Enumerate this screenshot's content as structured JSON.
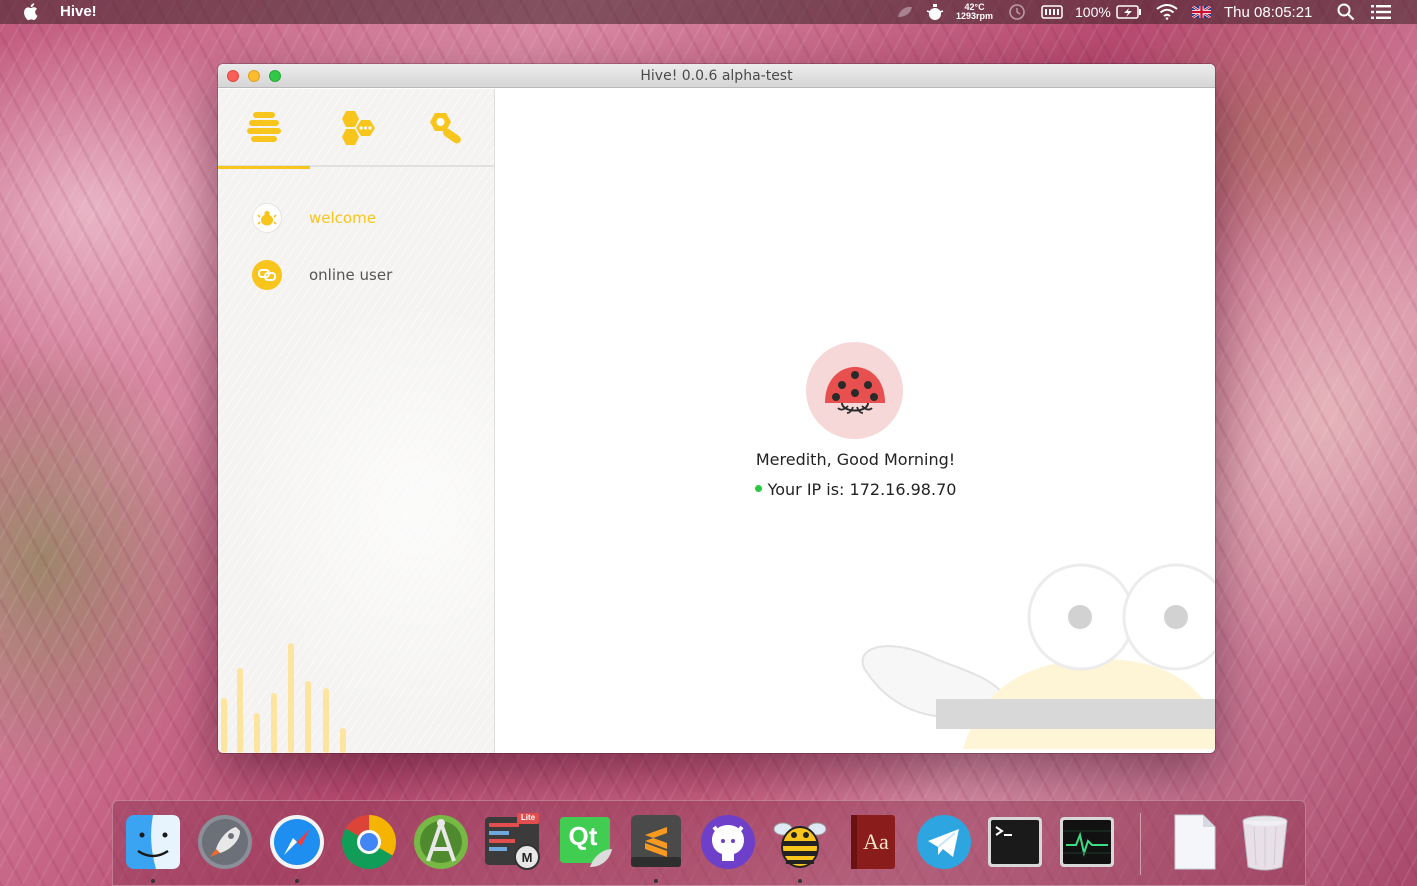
{
  "menubar": {
    "app_name": "Hive!",
    "temperature": "42°C",
    "fan_speed": "1293rpm",
    "battery_percent": "100%",
    "clock": "Thu 08:05:21"
  },
  "window": {
    "title": "Hive! 0.0.6 alpha-test",
    "tabs": [
      {
        "icon": "honeycomb-stack-icon",
        "active": true
      },
      {
        "icon": "chat-hexagons-icon",
        "active": false
      },
      {
        "icon": "wrench-icon",
        "active": false
      }
    ],
    "sidebar": {
      "items": [
        {
          "label": "welcome",
          "icon": "bee-icon",
          "active": true
        },
        {
          "label": "online user",
          "icon": "users-link-icon",
          "active": false
        }
      ]
    },
    "main": {
      "avatar_icon": "ladybug-icon",
      "greeting": "Meredith, Good Morning!",
      "ip_label": "Your IP is:",
      "ip_address": "172.16.98.70",
      "status_color": "#27c93f"
    }
  },
  "dock": {
    "apps": [
      {
        "name": "Finder",
        "running": true
      },
      {
        "name": "Launchpad",
        "running": false
      },
      {
        "name": "Safari",
        "running": true
      },
      {
        "name": "Google Chrome",
        "running": false
      },
      {
        "name": "Android Studio",
        "running": false
      },
      {
        "name": "MongoDB Lite",
        "running": false
      },
      {
        "name": "Qt Creator",
        "running": false
      },
      {
        "name": "Sublime Text",
        "running": true
      },
      {
        "name": "GitHub",
        "running": false
      },
      {
        "name": "Hive!",
        "running": true
      },
      {
        "name": "Dictionary",
        "running": false
      },
      {
        "name": "Telegram",
        "running": false
      },
      {
        "name": "Terminal",
        "running": false
      },
      {
        "name": "Activity Monitor",
        "running": false
      },
      {
        "name": "Documents",
        "running": false
      },
      {
        "name": "Trash",
        "running": false
      }
    ],
    "dictionary_label": "Aa",
    "qt_label": "Qt",
    "lite_label": "Lite"
  },
  "colors": {
    "accent": "#f8c51c",
    "nav_inactive": "#555555"
  }
}
